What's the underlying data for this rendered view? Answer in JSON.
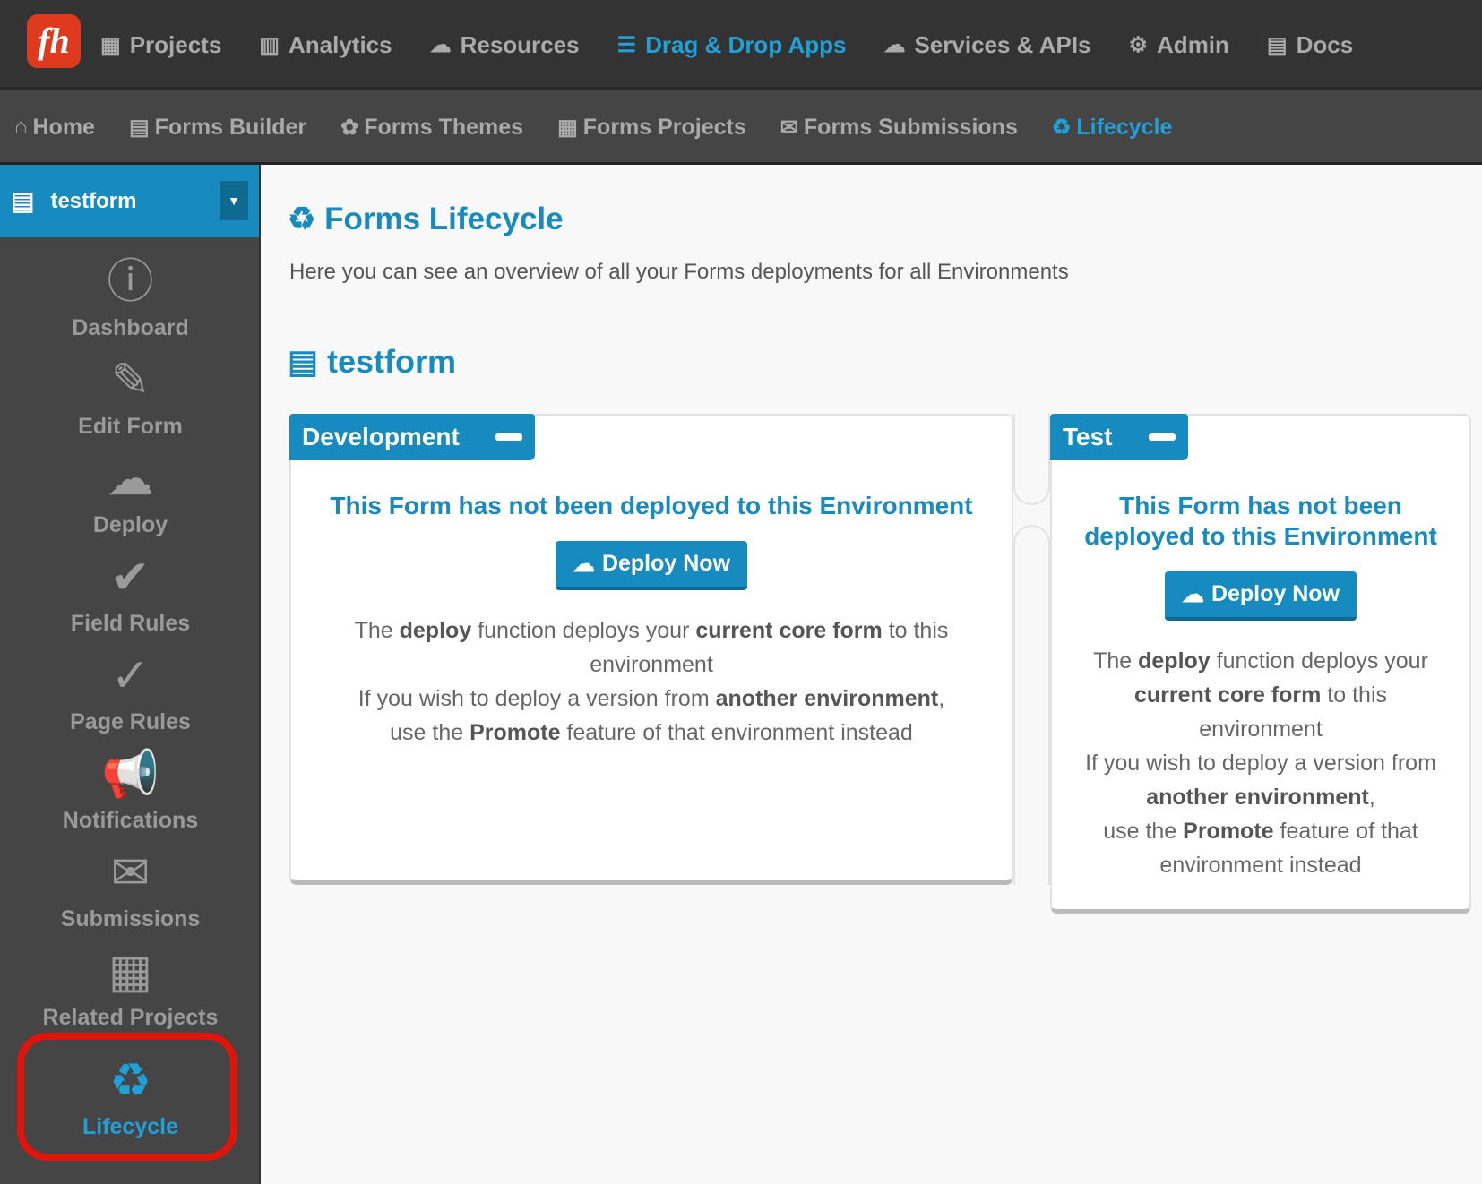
{
  "topnav": {
    "logo": "fh",
    "items": [
      {
        "label": "Projects",
        "icon": "grid-icon",
        "glyph": "▦"
      },
      {
        "label": "Analytics",
        "icon": "bar-chart-icon",
        "glyph": "▥"
      },
      {
        "label": "Resources",
        "icon": "cloud-icon",
        "glyph": "☁"
      },
      {
        "label": "Drag & Drop Apps",
        "icon": "tasks-icon",
        "glyph": "☰"
      },
      {
        "label": "Services & APIs",
        "icon": "cloud-upload-icon",
        "glyph": "☁"
      },
      {
        "label": "Admin",
        "icon": "gears-icon",
        "glyph": "⚙"
      },
      {
        "label": "Docs",
        "icon": "book-icon",
        "glyph": "▤"
      }
    ]
  },
  "subnav": {
    "items": [
      {
        "label": "Home",
        "icon": "home-icon",
        "glyph": "⌂"
      },
      {
        "label": "Forms Builder",
        "icon": "list-alt-icon",
        "glyph": "▤"
      },
      {
        "label": "Forms Themes",
        "icon": "palette-icon",
        "glyph": "✿"
      },
      {
        "label": "Forms Projects",
        "icon": "grid-icon",
        "glyph": "▦"
      },
      {
        "label": "Forms Submissions",
        "icon": "envelope-icon",
        "glyph": "✉"
      },
      {
        "label": "Lifecycle",
        "icon": "recycle-icon",
        "glyph": "♻"
      }
    ]
  },
  "sidebar": {
    "form_name": "testform",
    "items": [
      {
        "label": "Dashboard",
        "glyph": "ⓘ"
      },
      {
        "label": "Edit Form",
        "glyph": "✎"
      },
      {
        "label": "Deploy",
        "glyph": "☁"
      },
      {
        "label": "Field Rules",
        "glyph": "✔"
      },
      {
        "label": "Page Rules",
        "glyph": "✓"
      },
      {
        "label": "Notifications",
        "glyph": "📢"
      },
      {
        "label": "Submissions",
        "glyph": "✉"
      },
      {
        "label": "Related Projects",
        "glyph": "▦"
      },
      {
        "label": "Lifecycle",
        "glyph": "♻"
      }
    ]
  },
  "main": {
    "title": "Forms Lifecycle",
    "description": "Here you can see an overview of all your Forms deployments for all Environments",
    "form_name": "testform",
    "environments": [
      {
        "name": "Development",
        "status": "This Form has not been deployed to this Environment",
        "button": "Deploy Now"
      },
      {
        "name": "Test",
        "status": "This Form has not been deployed to this Environment",
        "button": "Deploy Now"
      }
    ],
    "text": {
      "t1": "The ",
      "b1": "deploy",
      "t2": " function deploys your ",
      "b2": "current core form",
      "t3": " to this environment",
      "t4": "If you wish to deploy a version from ",
      "b3": "another environment",
      "t5": ",",
      "t6": "use the ",
      "b4": "Promote",
      "t7": " feature of that environment instead"
    }
  },
  "colors": {
    "accent": "#178bbf",
    "active": "#1ea0d8",
    "highlight": "#e0140a"
  }
}
